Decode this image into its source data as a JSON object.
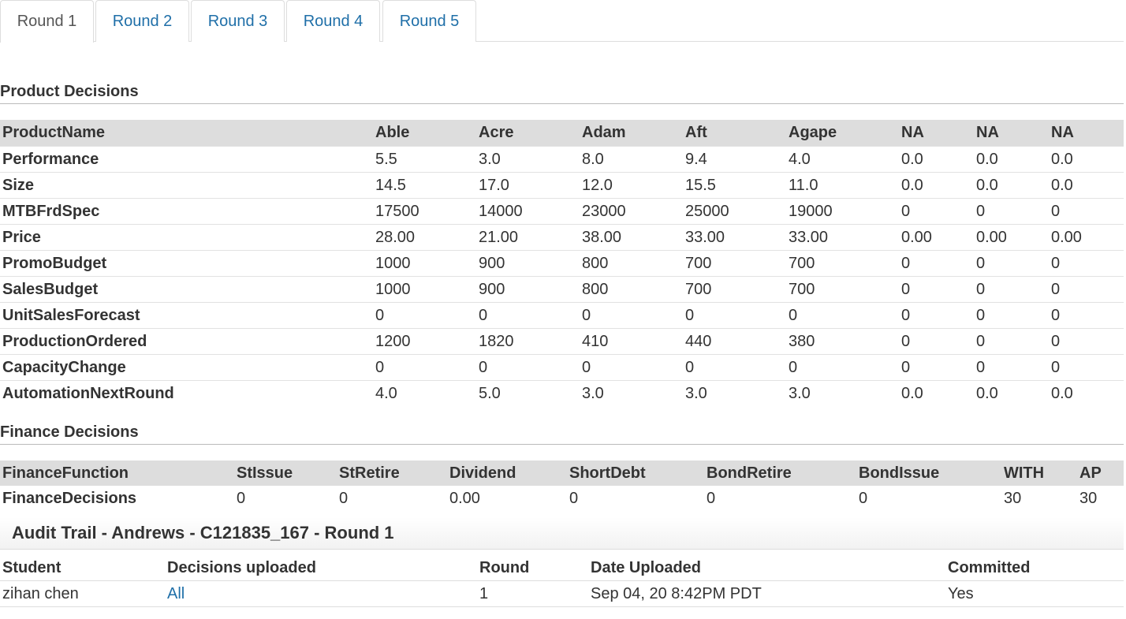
{
  "tabs": [
    {
      "label": "Round 1",
      "active": true
    },
    {
      "label": "Round 2",
      "active": false
    },
    {
      "label": "Round 3",
      "active": false
    },
    {
      "label": "Round 4",
      "active": false
    },
    {
      "label": "Round 5",
      "active": false
    }
  ],
  "product": {
    "title": "Product Decisions",
    "header": [
      "ProductName",
      "Able",
      "Acre",
      "Adam",
      "Aft",
      "Agape",
      "NA",
      "NA",
      "NA"
    ],
    "rows": [
      [
        "Performance",
        "5.5",
        "3.0",
        "8.0",
        "9.4",
        "4.0",
        "0.0",
        "0.0",
        "0.0"
      ],
      [
        "Size",
        "14.5",
        "17.0",
        "12.0",
        "15.5",
        "11.0",
        "0.0",
        "0.0",
        "0.0"
      ],
      [
        "MTBFrdSpec",
        "17500",
        "14000",
        "23000",
        "25000",
        "19000",
        "0",
        "0",
        "0"
      ],
      [
        "Price",
        "28.00",
        "21.00",
        "38.00",
        "33.00",
        "33.00",
        "0.00",
        "0.00",
        "0.00"
      ],
      [
        "PromoBudget",
        "1000",
        "900",
        "800",
        "700",
        "700",
        "0",
        "0",
        "0"
      ],
      [
        "SalesBudget",
        "1000",
        "900",
        "800",
        "700",
        "700",
        "0",
        "0",
        "0"
      ],
      [
        "UnitSalesForecast",
        "0",
        "0",
        "0",
        "0",
        "0",
        "0",
        "0",
        "0"
      ],
      [
        "ProductionOrdered",
        "1200",
        "1820",
        "410",
        "440",
        "380",
        "0",
        "0",
        "0"
      ],
      [
        "CapacityChange",
        "0",
        "0",
        "0",
        "0",
        "0",
        "0",
        "0",
        "0"
      ],
      [
        "AutomationNextRound",
        "4.0",
        "5.0",
        "3.0",
        "3.0",
        "3.0",
        "0.0",
        "0.0",
        "0.0"
      ]
    ]
  },
  "finance": {
    "title": "Finance Decisions",
    "header": [
      "FinanceFunction",
      "StIssue",
      "StRetire",
      "Dividend",
      "ShortDebt",
      "BondRetire",
      "BondIssue",
      "WITH",
      "AP"
    ],
    "rows": [
      [
        "FinanceDecisions",
        "0",
        "0",
        "0.00",
        "0",
        "0",
        "0",
        "30",
        "30"
      ]
    ]
  },
  "audit": {
    "title": "Audit Trail - Andrews - C121835_167 - Round 1",
    "header": [
      "Student",
      "Decisions uploaded",
      "Round",
      "Date Uploaded",
      "Committed"
    ],
    "rows": [
      [
        "zihan chen",
        "All",
        "1",
        "Sep 04, 20 8:42PM PDT",
        "Yes"
      ]
    ]
  }
}
